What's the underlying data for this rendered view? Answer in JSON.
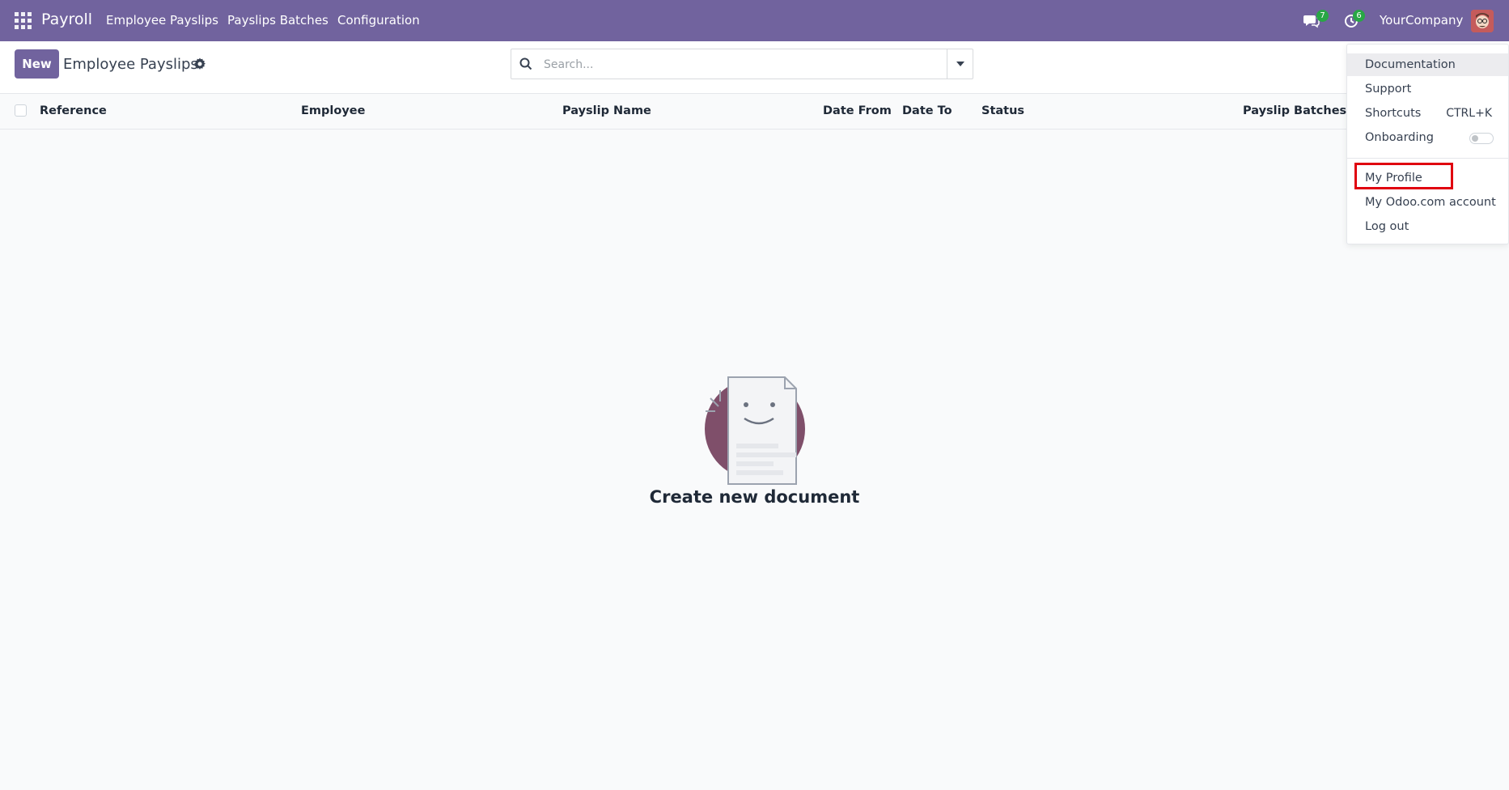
{
  "navbar": {
    "app_name": "Payroll",
    "menus": [
      "Employee Payslips",
      "Payslips Batches",
      "Configuration"
    ],
    "messages_count": "7",
    "activities_count": "6",
    "company": "YourCompany",
    "brand_color": "#71639e",
    "badge_color": "#28a745"
  },
  "control_panel": {
    "new_label": "New",
    "title": "Employee Payslips",
    "search_placeholder": "Search..."
  },
  "list": {
    "columns": [
      "Reference",
      "Employee",
      "Payslip Name",
      "Date From",
      "Date To",
      "Status",
      "Payslip Batches"
    ]
  },
  "empty_state": {
    "title": "Create new document"
  },
  "user_menu": {
    "documentation": "Documentation",
    "support": "Support",
    "shortcuts": "Shortcuts",
    "shortcuts_key": "CTRL+K",
    "onboarding": "Onboarding",
    "onboarding_enabled": false,
    "my_profile": "My Profile",
    "odoo_account": "My Odoo.com account",
    "logout": "Log out",
    "highlight_color": "#e0000f"
  }
}
